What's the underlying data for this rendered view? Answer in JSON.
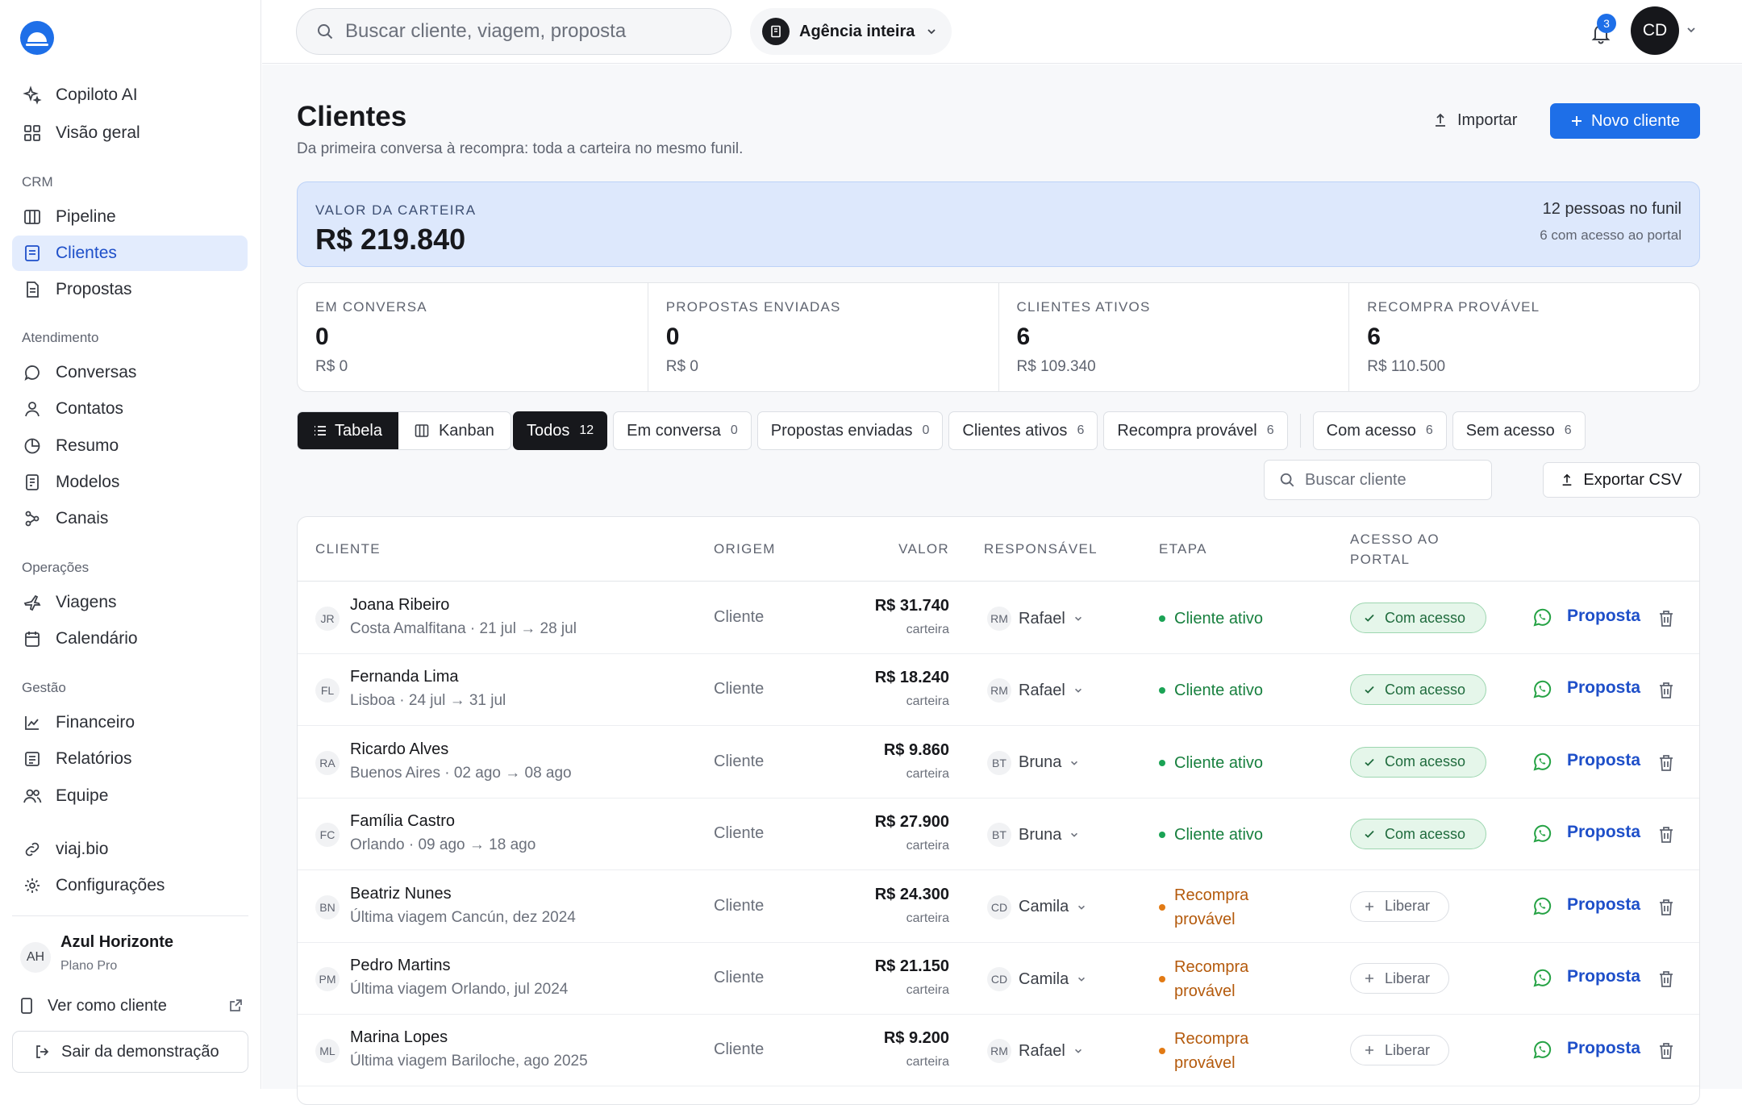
{
  "sidebar": {
    "top_items": [
      {
        "label": "Copiloto AI",
        "icon": "sparkle-icon"
      },
      {
        "label": "Visão geral",
        "icon": "grid-icon"
      }
    ],
    "sections": [
      {
        "title": "CRM",
        "items": [
          {
            "label": "Pipeline",
            "icon": "columns-icon"
          },
          {
            "label": "Clientes",
            "icon": "document-icon",
            "active": true
          },
          {
            "label": "Propostas",
            "icon": "file-text-icon"
          }
        ]
      },
      {
        "title": "Atendimento",
        "items": [
          {
            "label": "Conversas",
            "icon": "chat-icon"
          },
          {
            "label": "Contatos",
            "icon": "user-icon"
          },
          {
            "label": "Resumo",
            "icon": "pie-chart-icon"
          },
          {
            "label": "Modelos",
            "icon": "template-icon"
          },
          {
            "label": "Canais",
            "icon": "nodes-icon"
          }
        ]
      },
      {
        "title": "Operações",
        "items": [
          {
            "label": "Viagens",
            "icon": "plane-icon"
          },
          {
            "label": "Calendário",
            "icon": "calendar-icon"
          }
        ]
      },
      {
        "title": "Gestão",
        "items": [
          {
            "label": "Financeiro",
            "icon": "trend-chart-icon"
          },
          {
            "label": "Relatórios",
            "icon": "report-icon"
          },
          {
            "label": "Equipe",
            "icon": "users-icon"
          }
        ]
      }
    ],
    "extra_items": [
      {
        "label": "viaj.bio",
        "icon": "link-icon"
      },
      {
        "label": "Configurações",
        "icon": "gear-icon"
      }
    ],
    "org": {
      "initials": "AH",
      "name": "Azul Horizonte",
      "plan": "Plano Pro"
    },
    "view_as_client": "Ver como cliente",
    "exit_demo": "Sair da demonstração"
  },
  "topbar": {
    "search_placeholder": "Buscar cliente, viagem, proposta",
    "agency_scope": "Agência inteira",
    "notifications_count": "3",
    "user_initials": "CD"
  },
  "page": {
    "title": "Clientes",
    "subtitle": "Da primeira conversa à recompra: toda a carteira no mesmo funil.",
    "import_label": "Importar",
    "new_client_label": "Novo cliente"
  },
  "portfolio": {
    "label": "VALOR DA CARTEIRA",
    "value": "R$ 219.840",
    "people": "12 pessoas no funil",
    "portal": "6 com acesso ao portal"
  },
  "stats": [
    {
      "label": "EM CONVERSA",
      "value": "0",
      "amount": "R$ 0"
    },
    {
      "label": "PROPOSTAS ENVIADAS",
      "value": "0",
      "amount": "R$ 0"
    },
    {
      "label": "CLIENTES ATIVOS",
      "value": "6",
      "amount": "R$ 109.340"
    },
    {
      "label": "RECOMPRA PROVÁVEL",
      "value": "6",
      "amount": "R$ 110.500"
    }
  ],
  "views": {
    "table": "Tabela",
    "kanban": "Kanban"
  },
  "filters": [
    {
      "label": "Todos",
      "count": "12",
      "active": true
    },
    {
      "label": "Em conversa",
      "count": "0"
    },
    {
      "label": "Propostas enviadas",
      "count": "0"
    },
    {
      "label": "Clientes ativos",
      "count": "6"
    },
    {
      "label": "Recompra provável",
      "count": "6"
    }
  ],
  "access_filters": [
    {
      "label": "Com acesso",
      "count": "6"
    },
    {
      "label": "Sem acesso",
      "count": "6"
    }
  ],
  "table_search_placeholder": "Buscar cliente",
  "export_label": "Exportar CSV",
  "columns": {
    "client": "CLIENTE",
    "origin": "ORIGEM",
    "value": "VALOR",
    "owner": "RESPONSÁVEL",
    "stage": "ETAPA",
    "portal_line1": "ACESSO AO",
    "portal_line2": "PORTAL"
  },
  "rows": [
    {
      "initials": "JR",
      "name": "Joana Ribeiro",
      "detail": "Costa Amalfitana · 21 jul → 28 jul",
      "origin": "Cliente",
      "value": "R$ 31.740",
      "value_sub": "carteira",
      "owner_initials": "RM",
      "owner": "Rafael",
      "stage_line1": "Cliente ativo",
      "stage_line2": "",
      "stage_kind": "active",
      "access": "Com acesso",
      "has_access": true,
      "action": "Proposta"
    },
    {
      "initials": "FL",
      "name": "Fernanda Lima",
      "detail": "Lisboa · 24 jul → 31 jul",
      "origin": "Cliente",
      "value": "R$ 18.240",
      "value_sub": "carteira",
      "owner_initials": "RM",
      "owner": "Rafael",
      "stage_line1": "Cliente ativo",
      "stage_line2": "",
      "stage_kind": "active",
      "access": "Com acesso",
      "has_access": true,
      "action": "Proposta"
    },
    {
      "initials": "RA",
      "name": "Ricardo Alves",
      "detail": "Buenos Aires · 02 ago → 08 ago",
      "origin": "Cliente",
      "value": "R$ 9.860",
      "value_sub": "carteira",
      "owner_initials": "BT",
      "owner": "Bruna",
      "stage_line1": "Cliente ativo",
      "stage_line2": "",
      "stage_kind": "active",
      "access": "Com acesso",
      "has_access": true,
      "action": "Proposta"
    },
    {
      "initials": "FC",
      "name": "Família Castro",
      "detail": "Orlando · 09 ago → 18 ago",
      "origin": "Cliente",
      "value": "R$ 27.900",
      "value_sub": "carteira",
      "owner_initials": "BT",
      "owner": "Bruna",
      "stage_line1": "Cliente ativo",
      "stage_line2": "",
      "stage_kind": "active",
      "access": "Com acesso",
      "has_access": true,
      "action": "Proposta"
    },
    {
      "initials": "BN",
      "name": "Beatriz Nunes",
      "detail": "Última viagem Cancún, dez 2024",
      "origin": "Cliente",
      "value": "R$ 24.300",
      "value_sub": "carteira",
      "owner_initials": "CD",
      "owner": "Camila",
      "stage_line1": "Recompra",
      "stage_line2": "provável",
      "stage_kind": "likely",
      "access": "Liberar",
      "has_access": false,
      "action": "Proposta"
    },
    {
      "initials": "PM",
      "name": "Pedro Martins",
      "detail": "Última viagem Orlando, jul 2024",
      "origin": "Cliente",
      "value": "R$ 21.150",
      "value_sub": "carteira",
      "owner_initials": "CD",
      "owner": "Camila",
      "stage_line1": "Recompra",
      "stage_line2": "provável",
      "stage_kind": "likely",
      "access": "Liberar",
      "has_access": false,
      "action": "Proposta"
    },
    {
      "initials": "ML",
      "name": "Marina Lopes",
      "detail": "Última viagem Bariloche, ago 2025",
      "origin": "Cliente",
      "value": "R$ 9.200",
      "value_sub": "carteira",
      "owner_initials": "RM",
      "owner": "Rafael",
      "stage_line1": "Recompra",
      "stage_line2": "provável",
      "stage_kind": "likely",
      "access": "Liberar",
      "has_access": false,
      "action": "Proposta"
    }
  ],
  "colors": {
    "accent": "#1e6fe8",
    "active_stage": "#18803f",
    "likely_stage": "#b45a0c",
    "access_badge": "#e5f6ea",
    "whatsapp": "#25a244"
  }
}
